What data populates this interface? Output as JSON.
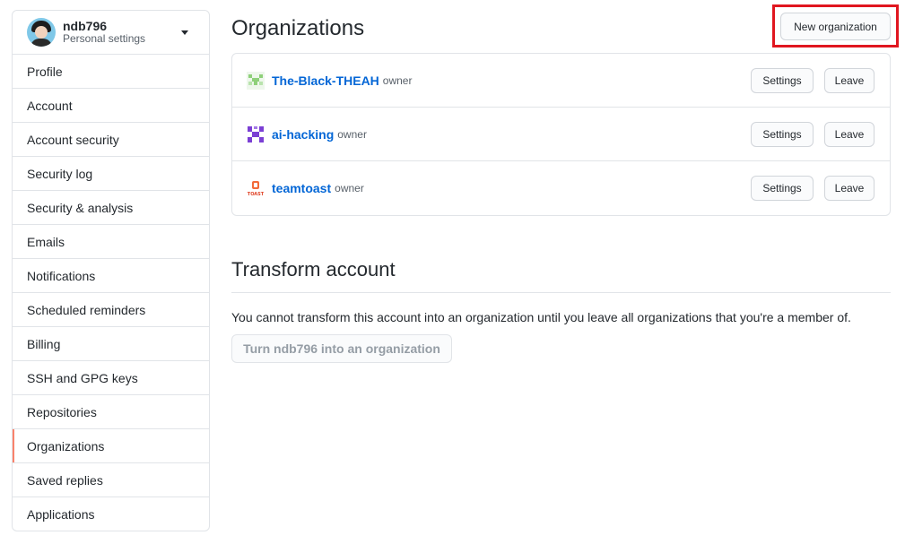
{
  "account": {
    "username": "ndb796",
    "subtitle": "Personal settings"
  },
  "sidebar": {
    "items": [
      {
        "label": "Profile",
        "selected": false
      },
      {
        "label": "Account",
        "selected": false
      },
      {
        "label": "Account security",
        "selected": false
      },
      {
        "label": "Security log",
        "selected": false
      },
      {
        "label": "Security & analysis",
        "selected": false
      },
      {
        "label": "Emails",
        "selected": false
      },
      {
        "label": "Notifications",
        "selected": false
      },
      {
        "label": "Scheduled reminders",
        "selected": false
      },
      {
        "label": "Billing",
        "selected": false
      },
      {
        "label": "SSH and GPG keys",
        "selected": false
      },
      {
        "label": "Repositories",
        "selected": false
      },
      {
        "label": "Organizations",
        "selected": true
      },
      {
        "label": "Saved replies",
        "selected": false
      },
      {
        "label": "Applications",
        "selected": false
      }
    ],
    "selected_accent": "#f9826c"
  },
  "organizations": {
    "title": "Organizations",
    "new_button_label": "New organization",
    "items": [
      {
        "name": "The-Black-THEAH",
        "role": "owner",
        "settings_label": "Settings",
        "leave_label": "Leave",
        "logo": "green-identicon"
      },
      {
        "name": "ai-hacking",
        "role": "owner",
        "settings_label": "Settings",
        "leave_label": "Leave",
        "logo": "purple-identicon"
      },
      {
        "name": "teamtoast",
        "role": "owner",
        "settings_label": "Settings",
        "leave_label": "Leave",
        "logo": "toast-logo",
        "logo_text": "TOAST"
      }
    ]
  },
  "transform": {
    "title": "Transform account",
    "description": "You cannot transform this account into an organization until you leave all organizations that you're a member of.",
    "button_label": "Turn ndb796 into an organization"
  },
  "colors": {
    "link": "#0366d6",
    "highlight": "#e0161f"
  }
}
